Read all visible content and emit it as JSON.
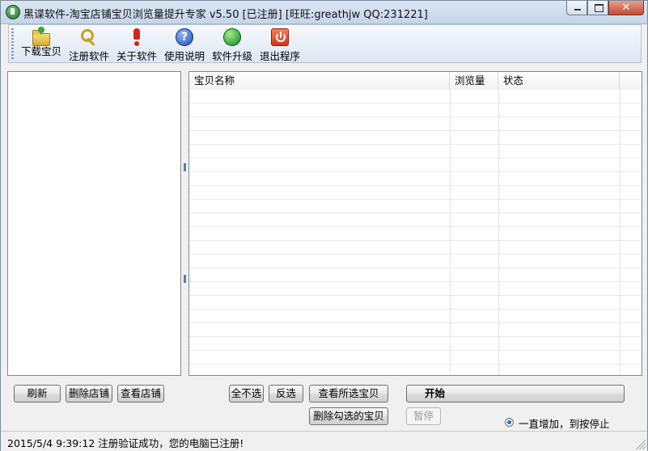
{
  "window": {
    "title": "黑谍软件-淘宝店铺宝贝浏览量提升专家 v5.50 [已注册] [旺旺:greathjw QQ:231221]",
    "close_glyph": "✕"
  },
  "toolbar": {
    "items": [
      {
        "label": "下载宝贝",
        "icon": "folder-download-icon"
      },
      {
        "label": "注册软件",
        "icon": "keys-icon"
      },
      {
        "label": "关于软件",
        "icon": "exclamation-icon"
      },
      {
        "label": "使用说明",
        "icon": "help-icon",
        "glyph": "?"
      },
      {
        "label": "软件升级",
        "icon": "globe-upgrade-icon"
      },
      {
        "label": "退出程序",
        "icon": "power-exit-icon"
      }
    ]
  },
  "list": {
    "columns": [
      "宝贝名称",
      "浏览量",
      "状态"
    ],
    "rows": []
  },
  "buttons": {
    "refresh": "刷新",
    "delete_shop": "删除店铺",
    "view_shop": "查看店铺",
    "select_none": "全不选",
    "invert_select": "反选",
    "view_selected": "查看所选宝贝",
    "delete_checked": "删除勾选的宝贝",
    "start": "开始",
    "pause": "暂停"
  },
  "options": {
    "keep_adding_label": "一直增加，到按停止"
  },
  "status": {
    "text": "2015/5/4 9:39:12  注册验证成功，您的电脑已注册!"
  },
  "colors": {
    "toolbar_bg": "#dde6f1",
    "titlebar_bg": "#c5d5e8",
    "close_button": "#c44a32"
  }
}
